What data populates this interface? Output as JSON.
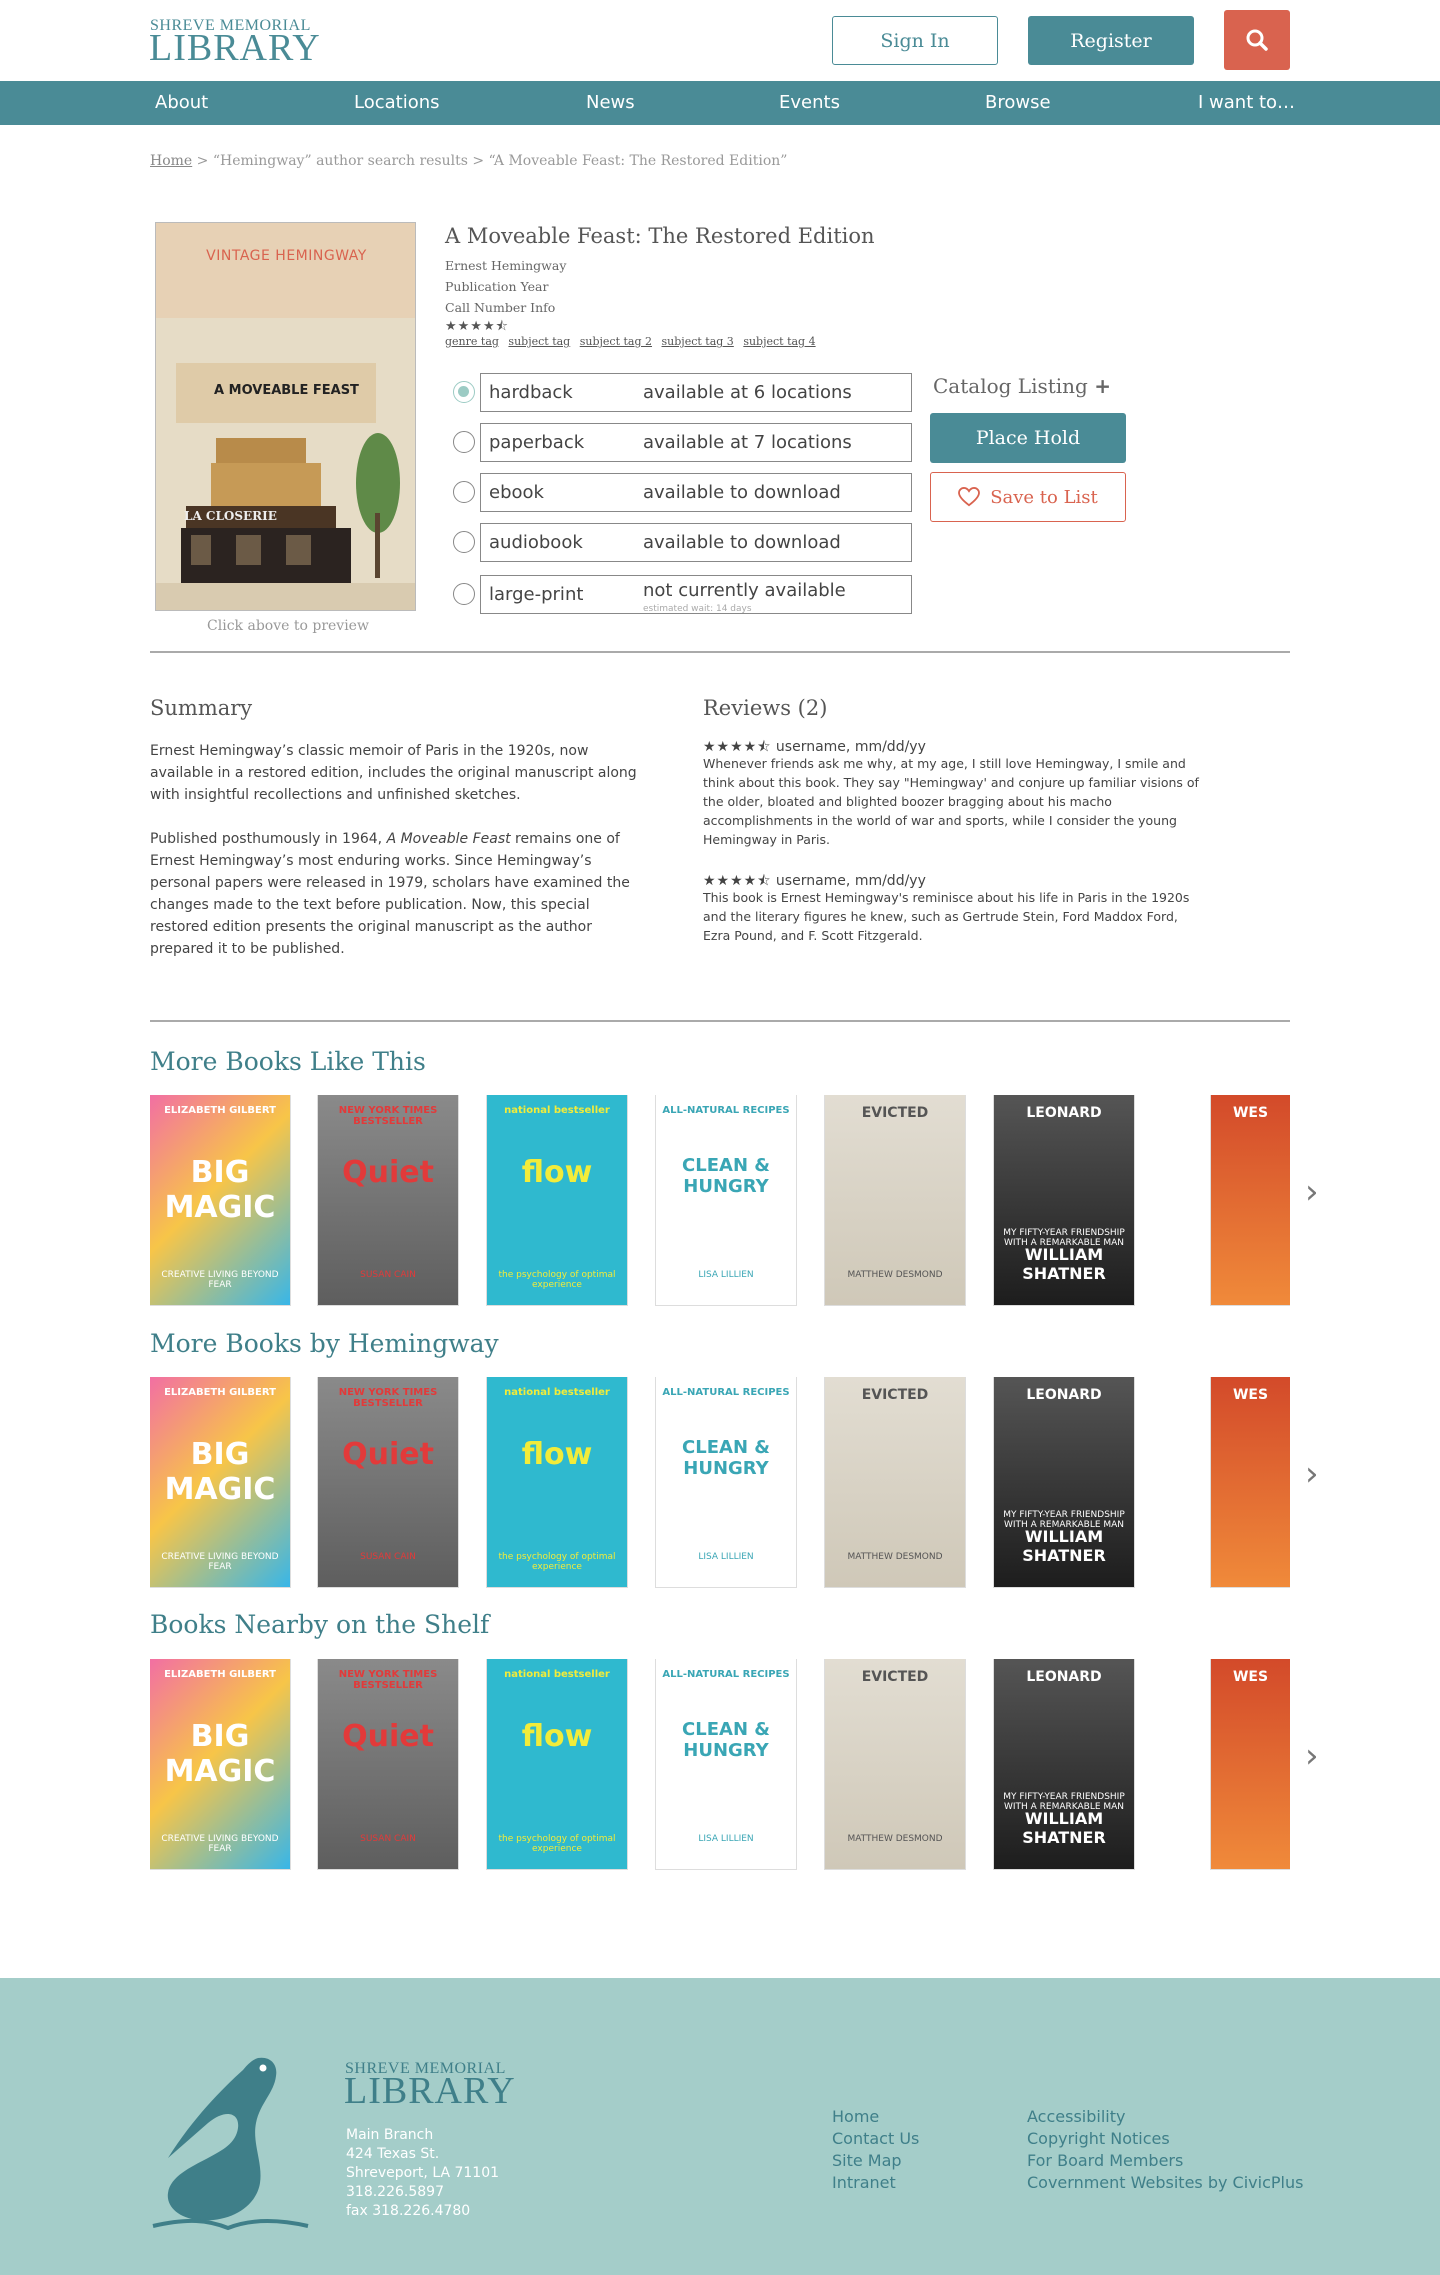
{
  "header": {
    "logo_small": "SHREVE MEMORIAL",
    "logo_big": "LIBRARY",
    "signin_label": "Sign In",
    "register_label": "Register",
    "search_icon": "search-icon"
  },
  "nav": [
    "About",
    "Locations",
    "News",
    "Events",
    "Browse",
    "I want to…"
  ],
  "breadcrumb": {
    "home": "Home",
    "rest": " > “Hemingway” author search results > “A Moveable Feast: The Restored Edition”"
  },
  "book": {
    "cover_brand": "VINTAGE HEMINGWAY",
    "cover_title": "A MOVEABLE FEAST",
    "cover_sign": "LA CLOSERIE",
    "preview_hint": "Click above to preview",
    "title": "A Moveable Feast: The Restored Edition",
    "author": "Ernest Hemingway",
    "pub_year": "Publication Year",
    "call_number": "Call Number Info",
    "rating": 4.5,
    "tags": [
      "genre tag",
      "subject tag",
      "subject tag 2",
      "subject tag 3",
      "subject tag 4"
    ]
  },
  "formats": [
    {
      "name": "hardback",
      "availability": "available at 6 locations",
      "note": "",
      "selected": true
    },
    {
      "name": "paperback",
      "availability": "available at 7 locations",
      "note": "",
      "selected": false
    },
    {
      "name": "ebook",
      "availability": "available to download",
      "note": "",
      "selected": false
    },
    {
      "name": "audiobook",
      "availability": "available to download",
      "note": "",
      "selected": false
    },
    {
      "name": "large-print",
      "availability": "not currently available",
      "note": "estimated wait: 14 days",
      "selected": false
    }
  ],
  "actions": {
    "catalog_listing": "Catalog Listing",
    "catalog_plus": "+",
    "place_hold": "Place Hold",
    "save_to_list": "Save to List"
  },
  "summary": {
    "title": "Summary",
    "p1": "Ernest Hemingway’s classic memoir of Paris in the 1920s, now available in a restored edition, includes the original manuscript along with insightful recollections and unfinished sketches.",
    "p2_before": "Published posthumously in 1964, ",
    "p2_italic": "A Moveable Feast",
    "p2_after": " remains one of Ernest Hemingway’s most enduring works. Since Hemingway’s personal papers were released in 1979, scholars have examined the changes made to the text before publication. Now, this special restored edition presents the original manuscript as the author prepared it to be published."
  },
  "reviews": {
    "title": "Reviews (2)",
    "items": [
      {
        "rating": 4.5,
        "meta": "username, mm/dd/yy",
        "text": "Whenever friends ask me why, at my age, I still love Hemingway, I smile and think about this book. They say \"Hemingway' and conjure up familiar visions of the older, bloated and blighted boozer bragging about his macho accomplishments in the world of war and sports, while I consider the young Hemingway in Paris."
      },
      {
        "rating": 4.5,
        "meta": "username, mm/dd/yy",
        "text": "This book is Ernest Hemingway's reminisce about his life in Paris in the 1920s and the literary figures he knew, such as Gertrude Stein, Ford Maddox Ford, Ezra Pound, and F. Scott Fitzgerald."
      }
    ]
  },
  "rows": [
    {
      "title": "More Books Like This"
    },
    {
      "title": "More Books by Hemingway"
    },
    {
      "title": "Books Nearby on the Shelf"
    }
  ],
  "covers": [
    {
      "top": "ELIZABETH GILBERT",
      "main": "BIG MAGIC",
      "sub": "CREATIVE LIVING BEYOND FEAR"
    },
    {
      "top": "NEW YORK TIMES BESTSELLER",
      "main": "Quiet",
      "sub": "SUSAN CAIN"
    },
    {
      "top": "national bestseller",
      "main": "flow",
      "sub": "the psychology of optimal experience"
    },
    {
      "top": "ALL-NATURAL RECIPES",
      "main": "CLEAN & HUNGRY",
      "sub": "LISA LILLIEN"
    },
    {
      "top": "EVICTED",
      "main": "",
      "sub": "MATTHEW DESMOND"
    },
    {
      "top": "LEONARD",
      "main": "WILLIAM SHATNER",
      "sub": "MY FIFTY-YEAR FRIENDSHIP WITH A REMARKABLE MAN"
    },
    {
      "top": "WES",
      "main": "",
      "sub": ""
    }
  ],
  "footer": {
    "logo_small": "SHREVE MEMORIAL",
    "logo_big": "LIBRARY",
    "address": [
      "Main Branch",
      "424 Texas St.",
      "Shreveport, LA 71101",
      "318.226.5897",
      "fax 318.226.4780"
    ],
    "links_col1": [
      "Home",
      "Contact Us",
      "Site Map",
      "Intranet"
    ],
    "links_col2": [
      "Accessibility",
      "Copyright Notices",
      "For Board Members",
      "Covernment Websites by CivicPlus"
    ]
  },
  "colors": {
    "accent": "#4a8b96",
    "alert": "#d9634f",
    "footer_bg": "#a4cdc9"
  }
}
